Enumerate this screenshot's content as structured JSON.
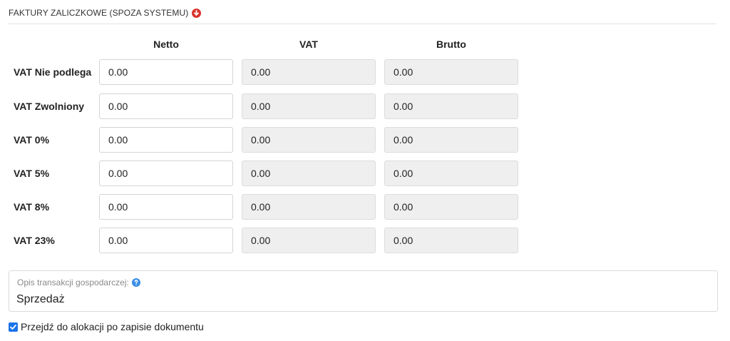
{
  "section": {
    "title": "FAKTURY ZALICZKOWE (SPOZA SYSTEMU)",
    "toggle_icon": "arrow-down-circle-icon",
    "accent_color": "#d9342b"
  },
  "columns": [
    "Netto",
    "VAT",
    "Brutto"
  ],
  "rows": [
    {
      "label": "VAT Nie podlega",
      "netto": "0.00",
      "vat": "0.00",
      "brutto": "0.00"
    },
    {
      "label": "VAT Zwolniony",
      "netto": "0.00",
      "vat": "0.00",
      "brutto": "0.00"
    },
    {
      "label": "VAT 0%",
      "netto": "0.00",
      "vat": "0.00",
      "brutto": "0.00"
    },
    {
      "label": "VAT 5%",
      "netto": "0.00",
      "vat": "0.00",
      "brutto": "0.00"
    },
    {
      "label": "VAT 8%",
      "netto": "0.00",
      "vat": "0.00",
      "brutto": "0.00"
    },
    {
      "label": "VAT 23%",
      "netto": "0.00",
      "vat": "0.00",
      "brutto": "0.00"
    }
  ],
  "description": {
    "label": "Opis transakcji gospodarczej:",
    "help_icon": "help-circle-icon",
    "help_color": "#3a8ee6",
    "value": "Sprzedaż"
  },
  "allocation": {
    "label": "Przejdź do alokacji po zapisie dokumentu",
    "checked": true
  }
}
